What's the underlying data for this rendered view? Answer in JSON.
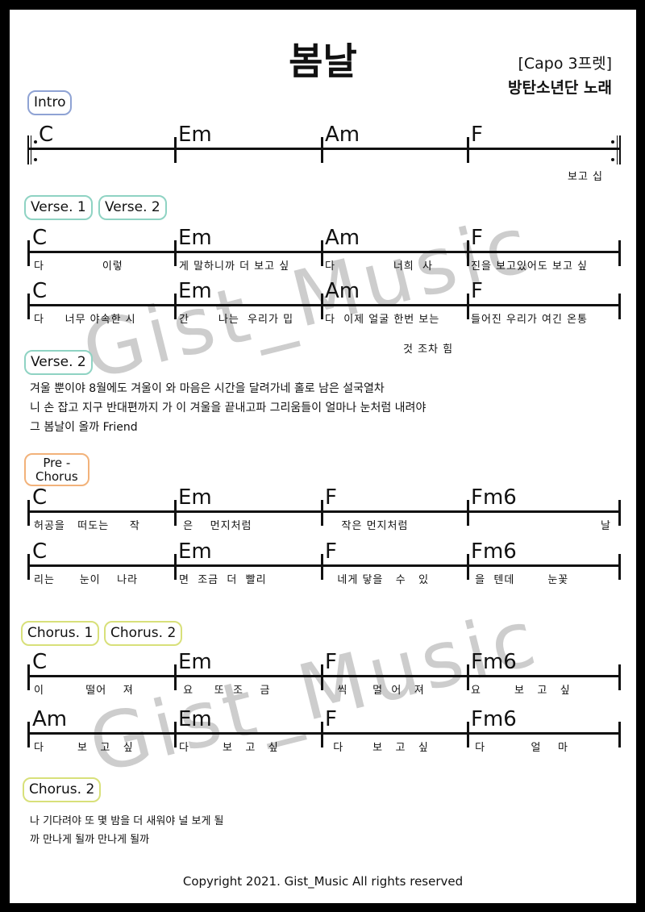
{
  "header": {
    "title": "봄날",
    "capo": "[Capo 3프렛]",
    "artist": "방탄소년단 노래"
  },
  "watermark": "Gist_Music",
  "colors": {
    "intro_badge": "#8fa3d4",
    "verse_badge": "#8fd3c3",
    "prechorus_badge": "#f2b27a",
    "chorus_badge": "#d8e07a",
    "watermark": "#bdbdbd"
  },
  "sections": {
    "intro": {
      "badges": [
        "Intro"
      ],
      "rows": [
        {
          "chords": [
            "C",
            "Em",
            "Am",
            "F"
          ],
          "lyrics": [
            "",
            "",
            "",
            "보고 십"
          ]
        }
      ]
    },
    "verse": {
      "badges": [
        "Verse. 1",
        "Verse. 2"
      ],
      "rows": [
        {
          "chords": [
            "C",
            "Em",
            "Am",
            "F"
          ],
          "lyrics": [
            "다              이렇",
            "게 말하니까 더 보고 싶",
            "다              너희  사",
            "진을 보고있어도 보고 싶"
          ]
        },
        {
          "chords": [
            "C",
            "Em",
            "Am",
            "F"
          ],
          "lyrics": [
            "다     너무 야속한 시",
            "간       나는  우리가 밉",
            "다  이제 얼굴 한번 보는",
            "들어진 우리가 여긴 온통"
          ]
        }
      ],
      "extra_line": "것 조차 힘"
    },
    "verse2_text": {
      "badges": [
        "Verse. 2"
      ],
      "lines": [
        "겨울 뿐이야 8월에도 겨울이 와 마음은 시간을 달려가네 홀로 남은 설국열차",
        "니 손 잡고 지구 반대편까지 가 이 겨울을 끝내고파 그리움들이 얼마나 눈처럼 내려야",
        "그 봄날이 올까 Friend"
      ]
    },
    "prechorus": {
      "badges": [
        "Pre -\nChorus"
      ],
      "rows": [
        {
          "chords": [
            "C",
            "Em",
            "F",
            "Fm6"
          ],
          "lyrics": [
            "허공을   떠도는     작",
            " 은    먼지처럼",
            "    작은 먼지처럼",
            "날"
          ]
        },
        {
          "chords": [
            "C",
            "Em",
            "F",
            "Fm6"
          ],
          "lyrics": [
            "리는      눈이    나라",
            "면  조금  더  빨리",
            "   네게 닿을   수   있",
            " 을  텐데        눈꽃"
          ]
        }
      ]
    },
    "chorus": {
      "badges": [
        "Chorus. 1",
        "Chorus. 2"
      ],
      "rows": [
        {
          "chords": [
            "C",
            "Em",
            "F",
            "Fm6"
          ],
          "lyrics": [
            "이          떨어    져",
            " 요     또  조    금",
            "   씩      멀  어   져",
            "요        보   고   싶"
          ]
        },
        {
          "chords": [
            "Am",
            "Em",
            "F",
            "Fm6"
          ],
          "lyrics": [
            "다        보   고   싶",
            "다        보   고   싶",
            "  다       보   고   싶",
            " 다           얼    마"
          ]
        }
      ]
    },
    "chorus2_text": {
      "badges": [
        "Chorus. 2"
      ],
      "lines": [
        "나 기다려야 또 몇 밤을 더 새워야 널 보게 될",
        "까 만나게 될까 만나게 될까"
      ]
    }
  },
  "footer": "Copyright 2021. Gist_Music All rights reserved"
}
